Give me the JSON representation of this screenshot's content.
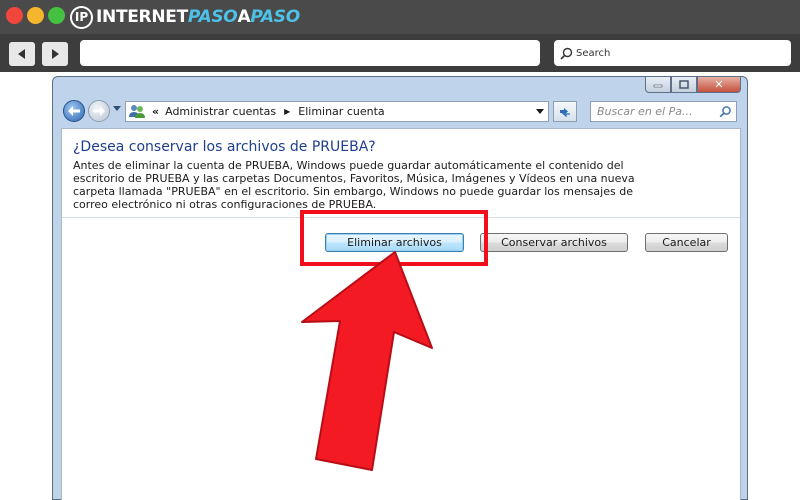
{
  "browser": {
    "logo": {
      "mark": "IP",
      "part1": "INTERNET",
      "part2": "PASO",
      "part3": "A",
      "part4": "PASO"
    },
    "search_label": "Search",
    "back_icon": "back-arrow-icon",
    "forward_icon": "forward-arrow-icon"
  },
  "window": {
    "breadcrumb": {
      "separator_start": "«",
      "item1": "Administrar cuentas",
      "separator": "▶",
      "item2": "Eliminar cuenta"
    },
    "search_placeholder": "Buscar en el Pa...",
    "heading": "¿Desea conservar los archivos de PRUEBA?",
    "description_lines": [
      "Antes de eliminar la cuenta de PRUEBA, Windows puede guardar automáticamente el contenido del",
      "escritorio de PRUEBA y las carpetas Documentos, Favoritos, Música, Imágenes y Vídeos en una nueva",
      "carpeta llamada \"PRUEBA\" en el escritorio. Sin embargo, Windows no puede guardar los mensajes de",
      "correo electrónico ni otras configuraciones de PRUEBA."
    ],
    "buttons": {
      "delete_files": "Eliminar archivos",
      "keep_files": "Conservar archivos",
      "cancel": "Cancelar"
    }
  },
  "colors": {
    "heading": "#1e3f8f",
    "highlight": "#f00f1a",
    "logo_accent": "#4ec1e8"
  }
}
